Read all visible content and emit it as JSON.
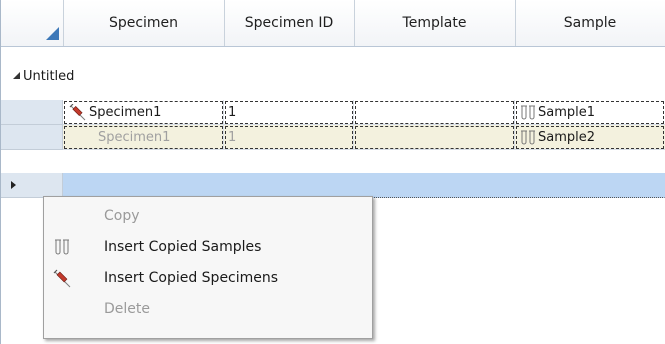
{
  "grid": {
    "columns": [
      "Specimen",
      "Specimen ID",
      "Template",
      "Sample"
    ],
    "group": {
      "label": "Untitled"
    },
    "rows": [
      {
        "specimen": "Specimen1",
        "specimen_id": "1",
        "template": "",
        "sample": "Sample1"
      },
      {
        "specimen": "Specimen1",
        "specimen_id": "1",
        "template": "",
        "sample": "Sample2"
      }
    ]
  },
  "context_menu": {
    "items": [
      {
        "label": "Copy",
        "icon": "",
        "enabled": false
      },
      {
        "label": "Insert Copied Samples",
        "icon": "test-tubes-icon",
        "enabled": true
      },
      {
        "label": "Insert Copied Specimens",
        "icon": "syringe-icon",
        "enabled": true
      },
      {
        "label": "Delete",
        "icon": "",
        "enabled": false
      }
    ]
  },
  "colors": {
    "header_accent": "#3d78b8",
    "new_row_highlight": "#bcd6f3",
    "copied_row_bg": "#f3f1de",
    "row_selector_bg": "#dde6f0"
  }
}
